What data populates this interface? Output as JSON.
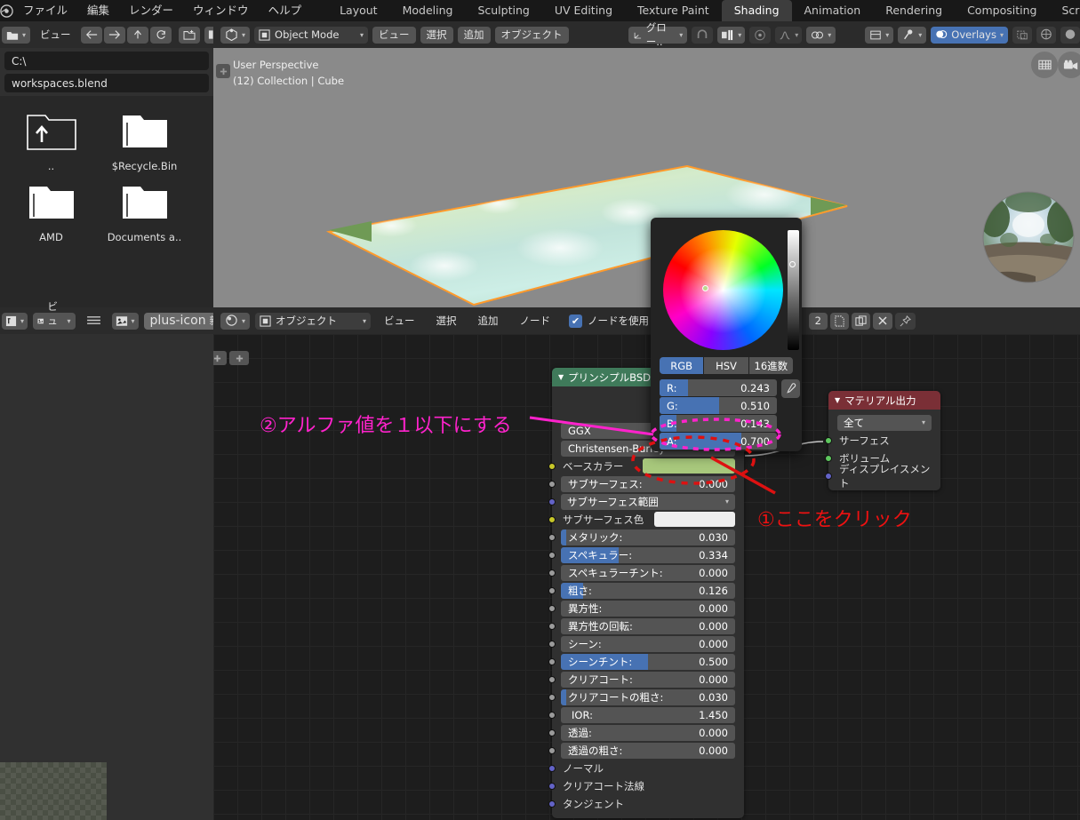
{
  "app": {
    "menus": [
      "ファイル",
      "編集",
      "レンダー",
      "ウィンドウ",
      "ヘルプ"
    ],
    "workspace_tabs": [
      {
        "label": "Layout",
        "active": false
      },
      {
        "label": "Modeling",
        "active": false
      },
      {
        "label": "Sculpting",
        "active": false
      },
      {
        "label": "UV Editing",
        "active": false
      },
      {
        "label": "Texture Paint",
        "active": false
      },
      {
        "label": "Shading",
        "active": true
      },
      {
        "label": "Animation",
        "active": false
      },
      {
        "label": "Rendering",
        "active": false
      },
      {
        "label": "Compositing",
        "active": false
      },
      {
        "label": "Scripting",
        "active": false
      }
    ],
    "add_workspace": "+"
  },
  "file_browser": {
    "header": {
      "editor_type_icon": "file-browser-icon",
      "view_menu": "ビュー",
      "nav_back_icon": "arrow-left-icon",
      "nav_forward_icon": "arrow-right-icon",
      "nav_parent_icon": "arrow-up-icon",
      "refresh_icon": "refresh-icon",
      "new_folder_icon": "new-folder-icon",
      "display_list_icon": "display-list-icon",
      "display_detail_icon": "display-detail-icon"
    },
    "path_value": "C:\\",
    "filename_value": "workspaces.blend",
    "path_placeholder": "C:\\",
    "filename_placeholder": "workspaces.blend",
    "entries": [
      {
        "label": "..",
        "icon": "folder-parent-icon"
      },
      {
        "label": "$Recycle.Bin",
        "icon": "folder-icon"
      },
      {
        "label": "AMD",
        "icon": "folder-icon"
      },
      {
        "label": "Documents a..",
        "icon": "folder-icon"
      }
    ]
  },
  "viewport": {
    "header": {
      "editor_type_icon": "3d-viewport-icon",
      "mode_label": "Object Mode",
      "mode_icon": "object-mode-icon",
      "menus": [
        "ビュー",
        "選択",
        "追加",
        "オブジェクト"
      ],
      "transform_orientation": "グロー..",
      "transform_icon": "orientation-icon",
      "snap_icon": "magnet-icon",
      "snap_target_icon": "snap-increment-icon",
      "proportional_icon": "proportional-editing-icon",
      "falloff_icon": "falloff-smooth-icon",
      "mirror_icon": "mirror-icon",
      "shading_type_icon": "shading-rendered-icon",
      "view_object_types_icon": "filter-icon",
      "gizmo_icon": "gizmo-icon",
      "overlays_label": "Overlays",
      "overlays_icon": "overlays-icon",
      "xray_icon": "xray-icon",
      "shading_solid_icon": "shading-solid-icon",
      "shading_material_icon": "shading-material-icon"
    },
    "info_line_1": "User Perspective",
    "info_line_2": "(12) Collection | Cube",
    "gizmo_grid_icon": "grid-floor-icon",
    "gizmo_camera_icon": "camera-icon",
    "hdri_preview": "hdri-sphere-preview",
    "object_outline_color": "#ff9a2b",
    "object_surface_color": "#b9dda6",
    "background_color": "#8a8a8a"
  },
  "shader_editor": {
    "header_left": {
      "editor_type_icon": "image-editor-icon",
      "view_menu": "ビュー",
      "hamburger_icon": "menu-icon",
      "browse_image_icon": "browse-image-icon",
      "new_button": "新規",
      "plus_icon": "plus-icon"
    },
    "header": {
      "editor_type_icon": "shader-editor-icon",
      "shader_type_label": "オブジェクト",
      "shader_type_icon": "object-icon",
      "menus": [
        "ビュー",
        "選択",
        "追加",
        "ノード"
      ],
      "use_nodes_label": "ノードを使用",
      "use_nodes_checked": true,
      "slot_number": "2",
      "new_material_icon": "new-material-icon",
      "copy_material_icon": "copy-material-icon",
      "unlink_icon": "x-unlink-icon",
      "pin_icon": "pin-icon"
    },
    "nodes": [
      {
        "name": "principled-bsdf",
        "title": "プリンシプルBSDF",
        "header_color": "#3f7a5a",
        "distribution": "GGX",
        "subsurface_method": "Christensen-Burley",
        "base_color_swatch": "#a8c87c",
        "subsurface_color_swatch": "#eeeeee",
        "properties": [
          {
            "label": "ベースカラー",
            "type": "color",
            "socket": "yellow"
          },
          {
            "label": "サブサーフェス:",
            "value": "0.000",
            "type": "slider",
            "fill": 0,
            "socket": "gray"
          },
          {
            "label": "サブサーフェス範囲",
            "type": "enum",
            "socket": "purple"
          },
          {
            "label": "サブサーフェス色",
            "type": "color2",
            "socket": "yellow"
          },
          {
            "label": "メタリック:",
            "value": "0.030",
            "type": "slider",
            "fill": 3,
            "socket": "gray"
          },
          {
            "label": "スペキュラー:",
            "value": "0.334",
            "type": "slider",
            "fill": 33,
            "socket": "gray"
          },
          {
            "label": "スペキュラーチント:",
            "value": "0.000",
            "type": "slider",
            "fill": 0,
            "socket": "gray"
          },
          {
            "label": "粗さ:",
            "value": "0.126",
            "type": "slider",
            "fill": 13,
            "socket": "gray"
          },
          {
            "label": "異方性:",
            "value": "0.000",
            "type": "slider",
            "fill": 0,
            "socket": "gray"
          },
          {
            "label": "異方性の回転:",
            "value": "0.000",
            "type": "slider",
            "fill": 0,
            "socket": "gray"
          },
          {
            "label": "シーン:",
            "value": "0.000",
            "type": "slider",
            "fill": 0,
            "socket": "gray"
          },
          {
            "label": "シーンチント:",
            "value": "0.500",
            "type": "slider",
            "fill": 50,
            "socket": "gray"
          },
          {
            "label": "クリアコート:",
            "value": "0.000",
            "type": "slider",
            "fill": 0,
            "socket": "gray"
          },
          {
            "label": "クリアコートの粗さ:",
            "value": "0.030",
            "type": "slider",
            "fill": 3,
            "socket": "gray"
          },
          {
            "label": "IOR:",
            "value": "1.450",
            "type": "slider",
            "fill": 0,
            "socket": "gray"
          },
          {
            "label": "透過:",
            "value": "0.000",
            "type": "slider",
            "fill": 0,
            "socket": "gray"
          },
          {
            "label": "透過の粗さ:",
            "value": "0.000",
            "type": "slider",
            "fill": 0,
            "socket": "gray"
          },
          {
            "label": "ノーマル",
            "type": "label",
            "socket": "purple"
          },
          {
            "label": "クリアコート法線",
            "type": "label",
            "socket": "purple"
          },
          {
            "label": "タンジェント",
            "type": "label",
            "socket": "purple"
          }
        ]
      },
      {
        "name": "material-output",
        "title": "マテリアル出力",
        "header_color": "#7a2f36",
        "target": "全て",
        "inputs": [
          {
            "label": "サーフェス",
            "socket": "green"
          },
          {
            "label": "ボリューム",
            "socket": "green"
          },
          {
            "label": "ディスプレイスメント",
            "socket": "purple"
          }
        ]
      }
    ]
  },
  "color_picker": {
    "tabs": [
      {
        "label": "RGB",
        "active": true
      },
      {
        "label": "HSV",
        "active": false
      },
      {
        "label": "16進数",
        "active": false
      }
    ],
    "channels": [
      {
        "label": "R:",
        "value": "0.243",
        "fill": 24.3
      },
      {
        "label": "G:",
        "value": "0.510",
        "fill": 51.0
      },
      {
        "label": "B:",
        "value": "0.143",
        "fill": 14.3
      },
      {
        "label": "A:",
        "value": "0.700",
        "fill": 70.0
      }
    ],
    "eyedropper_icon": "eyedropper-icon"
  },
  "annotations": [
    {
      "name": "annotation-step-2",
      "text": "②アルファ値を１以下にする",
      "color": "#ff22cc"
    },
    {
      "name": "annotation-step-1",
      "text": "①ここをクリック",
      "color": "#ee1111"
    }
  ]
}
